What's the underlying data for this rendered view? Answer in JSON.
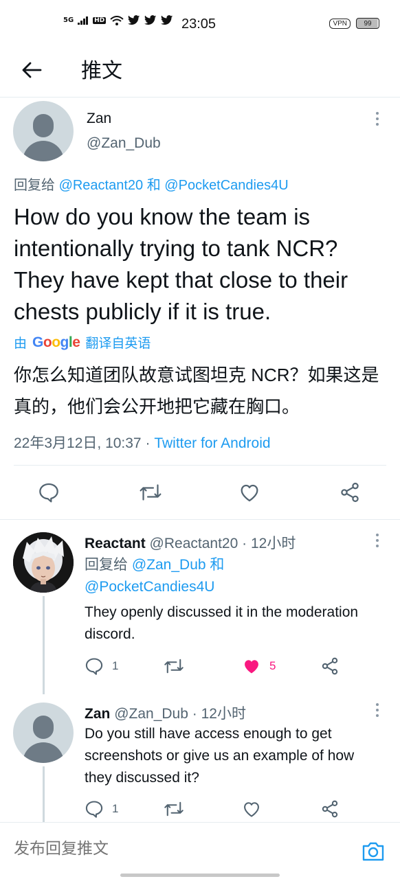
{
  "status_bar": {
    "network": "5G",
    "hd_label": "HD",
    "time": "23:05",
    "vpn_label": "VPN",
    "battery": "99"
  },
  "header": {
    "title": "推文"
  },
  "main_tweet": {
    "name": "Zan",
    "handle": "@Zan_Dub",
    "reply_prefix": "回复给",
    "reply_user_1": "@Reactant20",
    "reply_and": "和",
    "reply_user_2": "@PocketCandies4U",
    "text": "How do you know the team is intentionally trying to tank NCR? They have kept that close to their chests publicly if it is true.",
    "translate_prefix": "由",
    "translate_suffix": "翻译自英语",
    "translated_text": "你怎么知道团队故意试图坦克 NCR？如果这是真的，他们会公开地把它藏在胸口。",
    "date": "22年3月12日, 10:37",
    "separator": "·",
    "client": "Twitter for Android"
  },
  "replies": [
    {
      "name": "Reactant",
      "handle": "@Reactant20",
      "separator": "·",
      "time": "12小时",
      "reply_prefix": "回复给",
      "reply_user_1": "@Zan_Dub",
      "reply_and": "和",
      "reply_user_2": "@PocketCandies4U",
      "text": "They openly discussed it in the moderation discord.",
      "reply_count": "1",
      "like_count": "5",
      "liked": true,
      "like_color": "#f91880"
    },
    {
      "name": "Zan",
      "handle": "@Zan_Dub",
      "separator": "·",
      "time": "12小时",
      "text": "Do you still have access enough to get screenshots or give us an example of how they discussed it?",
      "reply_count": "1"
    }
  ],
  "composer": {
    "placeholder": "发布回复推文"
  },
  "colors": {
    "accent": "#1d9bf0",
    "secondary_text": "#536471",
    "divider": "#e6ecf0"
  },
  "icons": [
    "back-arrow-icon",
    "more-icon",
    "reply-icon",
    "retweet-icon",
    "like-icon",
    "share-icon",
    "camera-icon",
    "default-avatar-icon"
  ]
}
